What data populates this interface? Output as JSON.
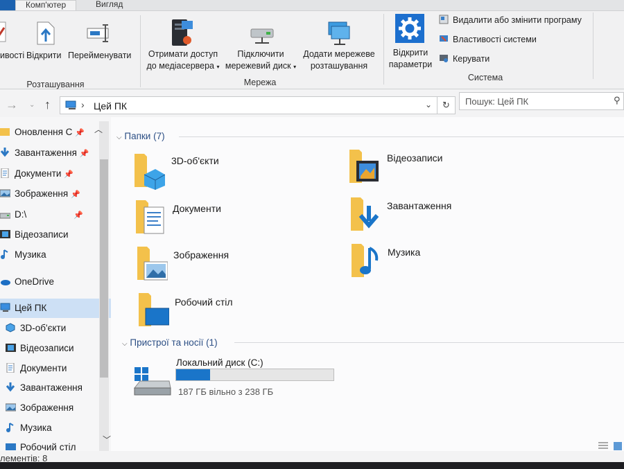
{
  "tabs": {
    "computer": "Комп'ютер",
    "view": "Вигляд"
  },
  "ribbon": {
    "location_group": {
      "label": "Розташування",
      "properties_partial": "ивості",
      "open": "Відкрити",
      "rename": "Перейменувати"
    },
    "network_group": {
      "label": "Мережа",
      "media_line1": "Отримати доступ",
      "media_line2": "до медіасервера",
      "map_line1": "Підключити",
      "map_line2": "мережевий диск",
      "add_line1": "Додати мережеве",
      "add_line2": "розташування"
    },
    "system_group": {
      "label": "Система",
      "open_settings_line1": "Відкрити",
      "open_settings_line2": "параметри",
      "uninstall": "Видалити або змінити програму",
      "system_properties": "Властивості системи",
      "manage": "Керувати"
    }
  },
  "address": {
    "current": "Цей ПК",
    "search_placeholder": "Пошук: Цей ПК"
  },
  "nav": {
    "quick": [
      {
        "label": "Оновлення С",
        "icon": "folder-icon",
        "pinned": true
      },
      {
        "label": "Завантаження",
        "icon": "download-icon",
        "pinned": true
      },
      {
        "label": "Документи",
        "icon": "documents-icon",
        "pinned": true
      },
      {
        "label": "Зображення",
        "icon": "pictures-icon",
        "pinned": true
      },
      {
        "label": "D:\\",
        "icon": "drive-icon",
        "pinned": true
      },
      {
        "label": "Відеозаписи",
        "icon": "videos-icon",
        "pinned": false
      },
      {
        "label": "Музика",
        "icon": "music-icon",
        "pinned": false
      }
    ],
    "onedrive": "OneDrive",
    "thispc": "Цей ПК",
    "pc_children": [
      {
        "label": "3D-об'єкти",
        "icon": "3d-objects-icon"
      },
      {
        "label": "Відеозаписи",
        "icon": "videos-icon"
      },
      {
        "label": "Документи",
        "icon": "documents-icon"
      },
      {
        "label": "Завантаження",
        "icon": "download-icon"
      },
      {
        "label": "Зображення",
        "icon": "pictures-icon"
      },
      {
        "label": "Музика",
        "icon": "music-icon"
      },
      {
        "label": "Робочий стіл",
        "icon": "desktop-icon"
      }
    ]
  },
  "content": {
    "folders_header": "Папки (7)",
    "folders": [
      {
        "name": "3D-об'єкти",
        "icon": "3d-objects-folder-icon"
      },
      {
        "name": "Відеозаписи",
        "icon": "videos-folder-icon"
      },
      {
        "name": "Документи",
        "icon": "documents-folder-icon"
      },
      {
        "name": "Завантаження",
        "icon": "downloads-folder-icon"
      },
      {
        "name": "Зображення",
        "icon": "pictures-folder-icon"
      },
      {
        "name": "Музика",
        "icon": "music-folder-icon"
      },
      {
        "name": "Робочий стіл",
        "icon": "desktop-folder-icon"
      }
    ],
    "devices_header": "Пристрої та носії (1)",
    "drive": {
      "name": "Локальний диск (C:)",
      "free_text": "187 ГБ вільно з 238 ГБ",
      "used_fraction": 0.214
    }
  },
  "status": {
    "items": "лементів: 8"
  },
  "colors": {
    "accent": "#1a75c9",
    "folder": "#f3c14b",
    "selected": "#cde0f5"
  }
}
